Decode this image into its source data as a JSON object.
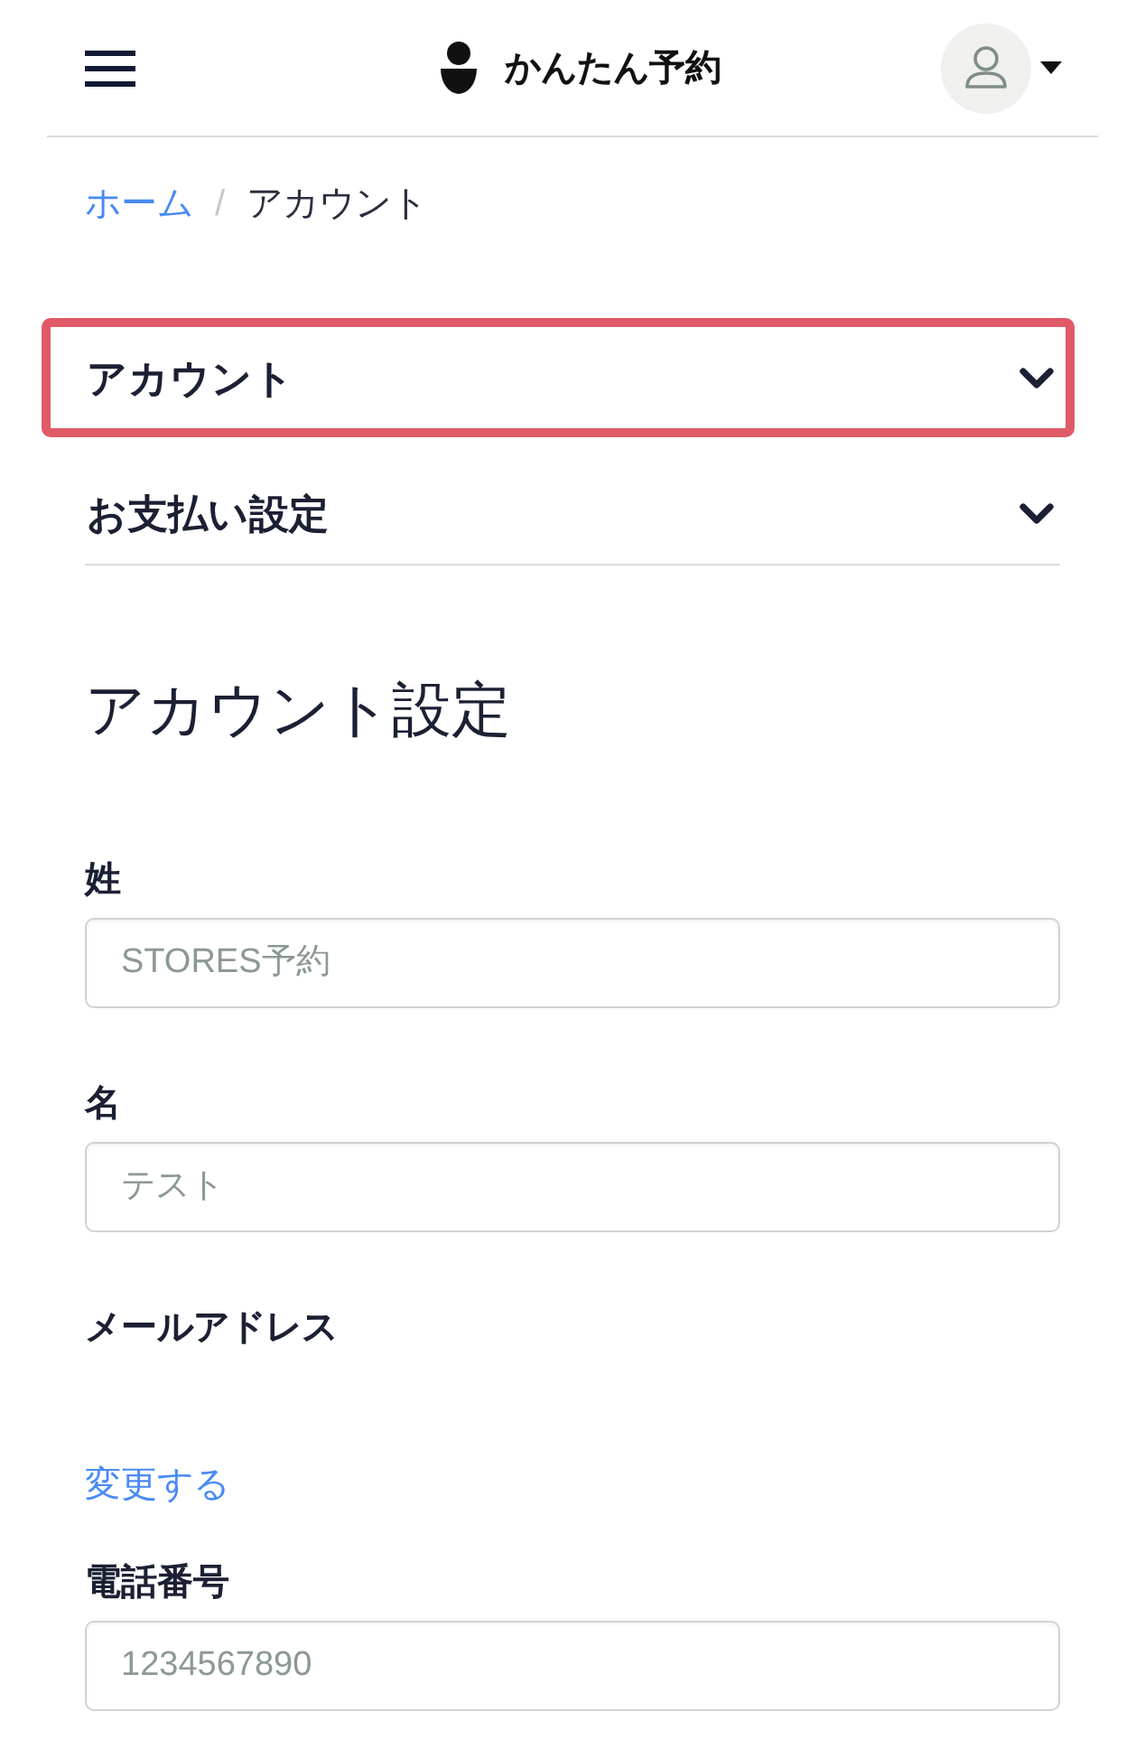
{
  "header": {
    "title": "かんたん予約"
  },
  "breadcrumb": {
    "separator": "/",
    "items": [
      {
        "label": "ホーム",
        "kind": "link"
      },
      {
        "label": "アカウント",
        "kind": "current"
      }
    ]
  },
  "accordion": [
    {
      "label": "アカウント",
      "expanded": false,
      "highlighted": true
    },
    {
      "label": "お支払い設定",
      "expanded": false,
      "highlighted": false
    }
  ],
  "section": {
    "title": "アカウント設定",
    "fields": [
      {
        "kind": "input",
        "label": "姓",
        "placeholder": "STORES予約"
      },
      {
        "kind": "input",
        "label": "名",
        "placeholder": "テスト"
      },
      {
        "kind": "email",
        "label": "メールアドレス",
        "link": "変更する"
      },
      {
        "kind": "input",
        "label": "電話番号",
        "placeholder": "1234567890"
      }
    ]
  }
}
